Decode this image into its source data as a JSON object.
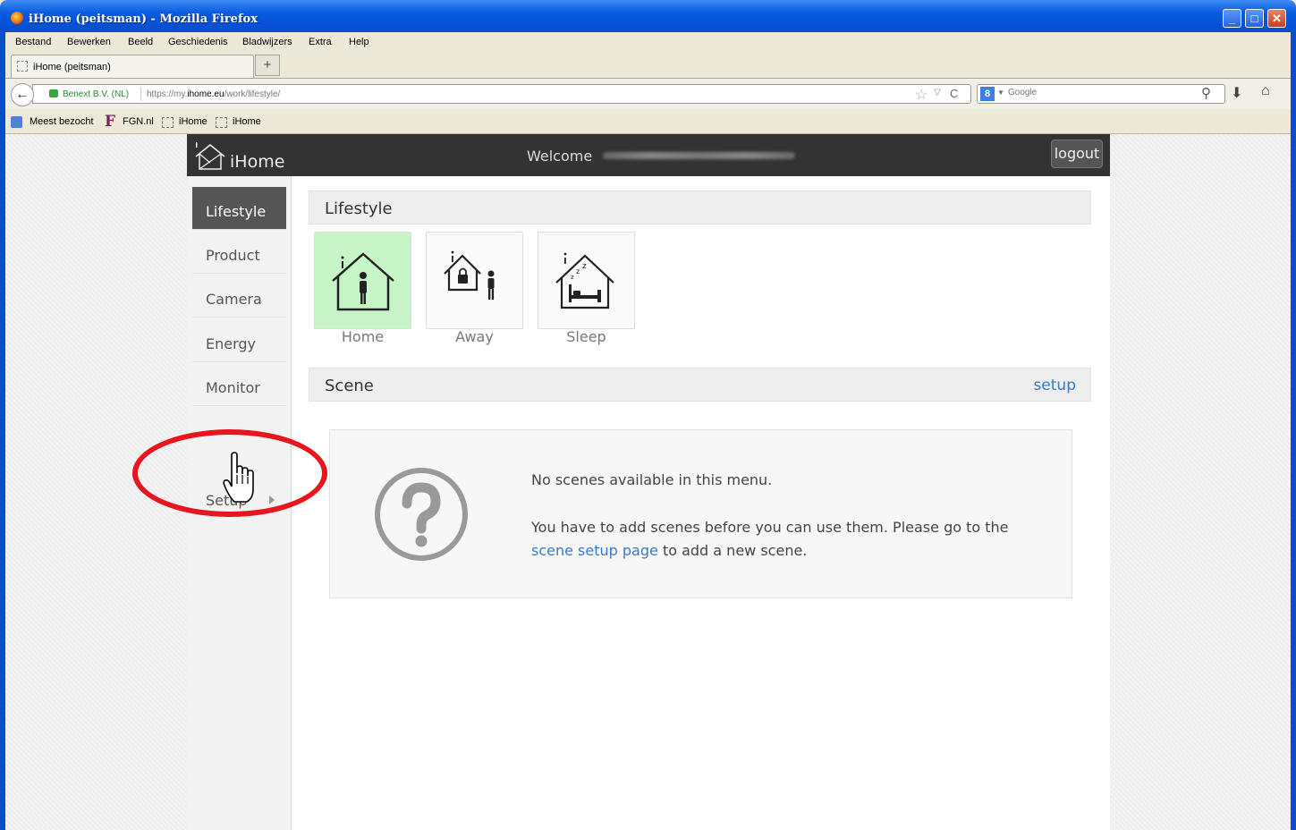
{
  "window": {
    "title": "iHome (peitsman) - Mozilla Firefox",
    "controls": [
      "minimize",
      "maximize",
      "close"
    ]
  },
  "menubar": [
    "Bestand",
    "Bewerken",
    "Beeld",
    "Geschiedenis",
    "Bladwijzers",
    "Extra",
    "Help"
  ],
  "tabs": [
    {
      "label": "iHome (peitsman)"
    }
  ],
  "newtab_label": "+",
  "navbar": {
    "identity": "Benext B.V. (NL)",
    "url_prefix": "https://my.",
    "url_domain": "ihome.eu",
    "url_path": "/work/lifestyle/",
    "search_placeholder": "Google"
  },
  "bookmarks": [
    "Meest bezocht",
    "FGN.nl",
    "iHome",
    "iHome"
  ],
  "app": {
    "logo": "iHome",
    "welcome": "Welcome",
    "logout": "logout",
    "sidebar": [
      {
        "label": "Lifestyle",
        "active": true
      },
      {
        "label": "Product",
        "active": false
      },
      {
        "label": "Camera",
        "active": false
      },
      {
        "label": "Energy",
        "active": false
      },
      {
        "label": "Monitor",
        "active": false
      }
    ],
    "setup_label": "Setup",
    "lifestyle_header": "Lifestyle",
    "lifestyles": [
      {
        "label": "Home",
        "icon": "home-person-icon",
        "active": true
      },
      {
        "label": "Away",
        "icon": "away-lock-icon",
        "active": false
      },
      {
        "label": "Sleep",
        "icon": "sleep-bed-icon",
        "active": false
      }
    ],
    "scene_header": "Scene",
    "scene_setup_link": "setup",
    "empty": {
      "line1": "No scenes available in this menu.",
      "line2_before": "You have to add scenes before you can use them. Please go to the",
      "line2_link": "scene setup page",
      "line2_after": "to add a new scene."
    }
  },
  "colors": {
    "active_tile": "#c8f5c8",
    "topbar": "#333333",
    "link": "#3a79c8",
    "annotation": "#e8141e"
  }
}
